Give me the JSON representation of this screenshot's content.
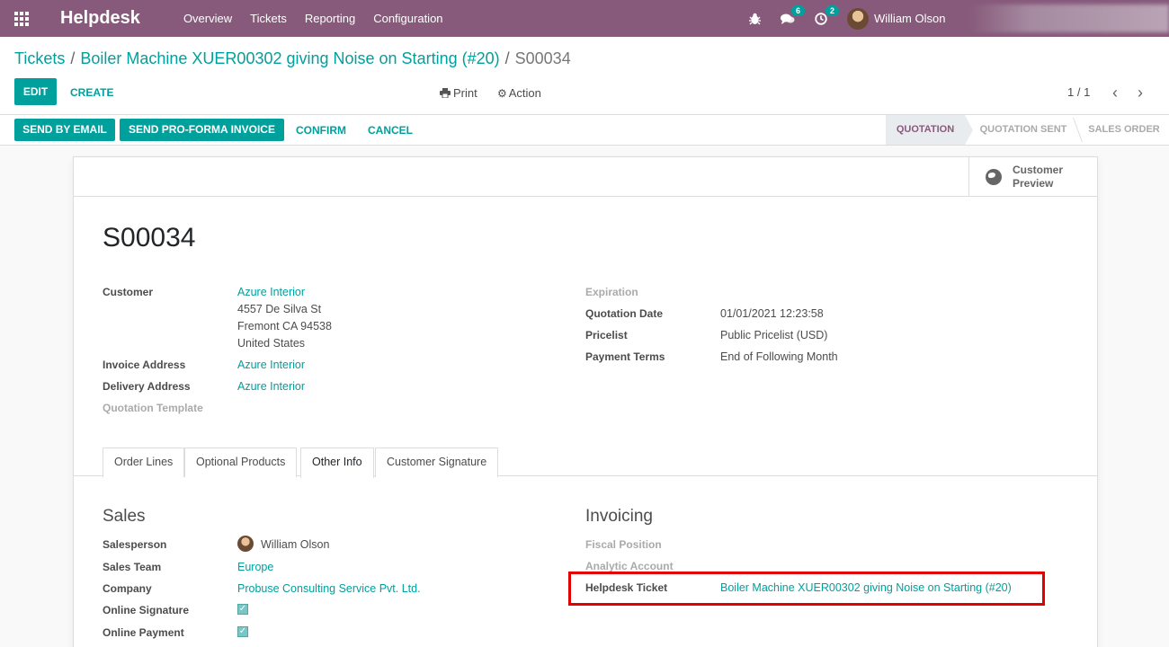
{
  "app": {
    "brand": "Helpdesk",
    "menu": [
      "Overview",
      "Tickets",
      "Reporting",
      "Configuration"
    ],
    "messages_count": "6",
    "activities_count": "2",
    "user_name": "William Olson"
  },
  "breadcrumb": {
    "root": "Tickets",
    "ticket": "Boiler Machine XUER00302 giving Noise on Starting (#20)",
    "current": "S00034"
  },
  "toolbar": {
    "edit": "EDIT",
    "create": "CREATE",
    "print": "Print",
    "action": "Action",
    "pager": "1 / 1"
  },
  "statusbar": {
    "send_email": "SEND BY EMAIL",
    "send_proforma": "SEND PRO-FORMA INVOICE",
    "confirm": "CONFIRM",
    "cancel": "CANCEL",
    "stages": [
      "QUOTATION",
      "QUOTATION SENT",
      "SALES ORDER"
    ],
    "active_stage": "QUOTATION"
  },
  "sheet": {
    "customer_preview": "Customer Preview",
    "name": "S00034",
    "left_fields": {
      "customer_label": "Customer",
      "customer_name": "Azure Interior",
      "address_line1": "4557 De Silva St",
      "address_line2": "Fremont CA 94538",
      "address_line3": "United States",
      "invoice_address_label": "Invoice Address",
      "invoice_address": "Azure Interior",
      "delivery_address_label": "Delivery Address",
      "delivery_address": "Azure Interior",
      "quotation_template_label": "Quotation Template"
    },
    "right_fields": {
      "expiration_label": "Expiration",
      "quotation_date_label": "Quotation Date",
      "quotation_date": "01/01/2021 12:23:58",
      "pricelist_label": "Pricelist",
      "pricelist": "Public Pricelist (USD)",
      "payment_terms_label": "Payment Terms",
      "payment_terms": "End of Following Month"
    },
    "tabs": [
      "Order Lines",
      "Optional Products",
      "Other Info",
      "Customer Signature"
    ],
    "active_tab": "Other Info",
    "sales": {
      "title": "Sales",
      "salesperson_label": "Salesperson",
      "salesperson": "William Olson",
      "sales_team_label": "Sales Team",
      "sales_team": "Europe",
      "company_label": "Company",
      "company": "Probuse Consulting Service Pvt. Ltd.",
      "online_signature_label": "Online Signature",
      "online_signature": true,
      "online_payment_label": "Online Payment",
      "online_payment": true
    },
    "invoicing": {
      "title": "Invoicing",
      "fiscal_position_label": "Fiscal Position",
      "analytic_account_label": "Analytic Account",
      "helpdesk_ticket_label": "Helpdesk Ticket",
      "helpdesk_ticket": "Boiler Machine XUER00302 giving Noise on Starting (#20)"
    }
  },
  "colors": {
    "navbar": "#875a7b",
    "primary": "#00a09d",
    "highlight": "#e00000"
  }
}
